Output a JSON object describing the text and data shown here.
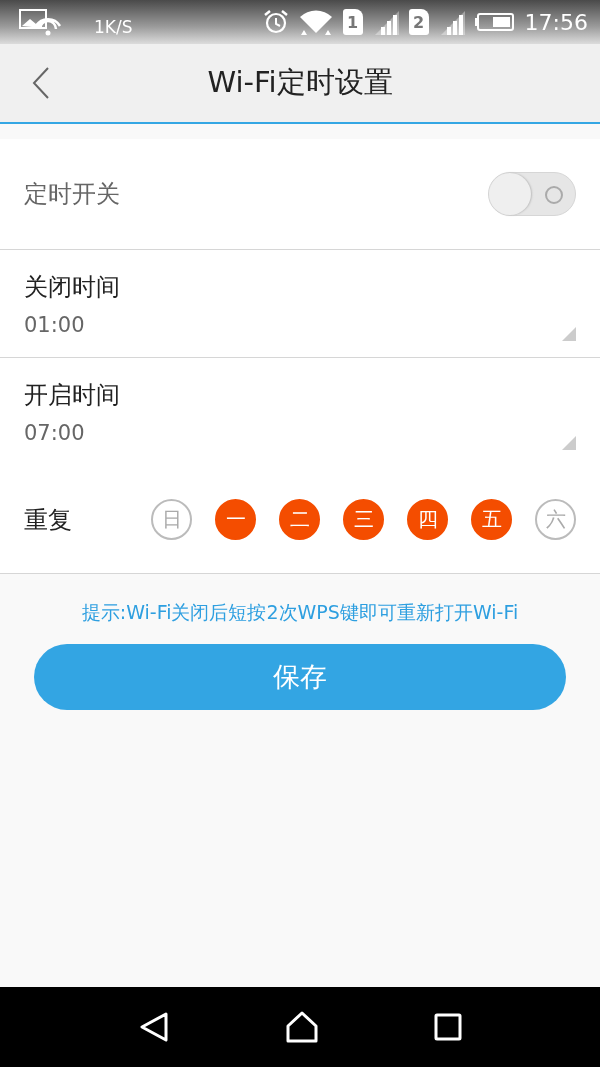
{
  "status_bar": {
    "speed": "1K/S",
    "sims": [
      "1",
      "2"
    ],
    "time": "17:56"
  },
  "header": {
    "title": "Wi-Fi定时设置"
  },
  "timer_switch": {
    "label": "定时开关",
    "on": false
  },
  "time_fields": [
    {
      "label": "关闭时间",
      "value": "01:00"
    },
    {
      "label": "开启时间",
      "value": "07:00"
    }
  ],
  "repeat": {
    "label": "重复",
    "days": [
      {
        "label": "日",
        "selected": false
      },
      {
        "label": "一",
        "selected": true
      },
      {
        "label": "二",
        "selected": true
      },
      {
        "label": "三",
        "selected": true
      },
      {
        "label": "四",
        "selected": true
      },
      {
        "label": "五",
        "selected": true
      },
      {
        "label": "六",
        "selected": false
      }
    ]
  },
  "hint": "提示:Wi-Fi关闭后短按2次WPS键即可重新打开Wi-Fi",
  "save_button": "保存"
}
